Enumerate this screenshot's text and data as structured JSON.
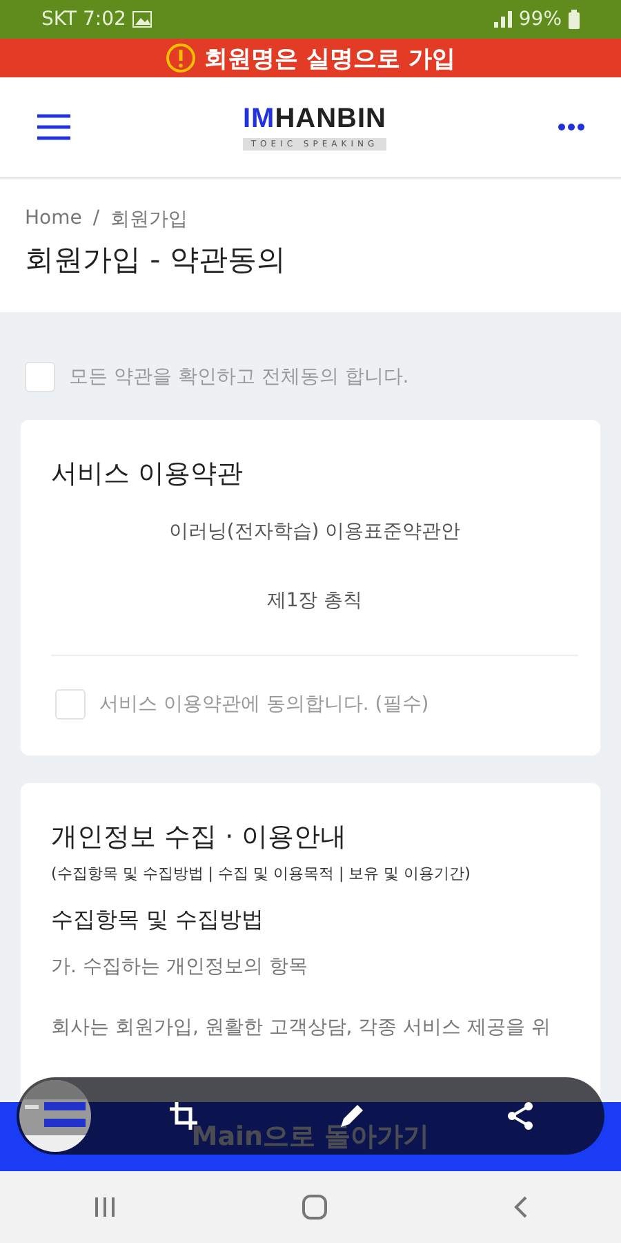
{
  "status_bar": {
    "carrier_time": "SKT 7:02",
    "battery": "99%"
  },
  "notice_banner": {
    "text": "회원명은 실명으로 가입"
  },
  "header": {
    "logo": {
      "brand_accent": "IM",
      "brand": "HANBIN",
      "tagline": "TOEIC SPEAKING"
    }
  },
  "breadcrumb": {
    "items": [
      "Home",
      "회원가입"
    ],
    "separator": "/"
  },
  "page_title": "회원가입 - 약관동의",
  "agree_all": {
    "label": "모든 약관을 확인하고 전체동의 합니다.",
    "checked": false
  },
  "terms_card": {
    "title": "서비스 이용약관",
    "lines": [
      "이러닝(전자학습) 이용표준약관안",
      "제1장 총칙"
    ],
    "agree": {
      "label": "서비스 이용약관에 동의합니다. (필수)",
      "checked": false
    }
  },
  "privacy_card": {
    "title": "개인정보 수집 · 이용안내",
    "subtitle": "(수집항목 및 수집방법 | 수집 및 이용목적 | 보유 및 이용기간)",
    "heading": "수집항목 및 수집방법",
    "lines": [
      "가. 수집하는 개인정보의 항목",
      "회사는 회원가입, 원활한 고객상담, 각종 서비스 제공을 위"
    ]
  },
  "bottom_button": "Main으로 돌아가기"
}
